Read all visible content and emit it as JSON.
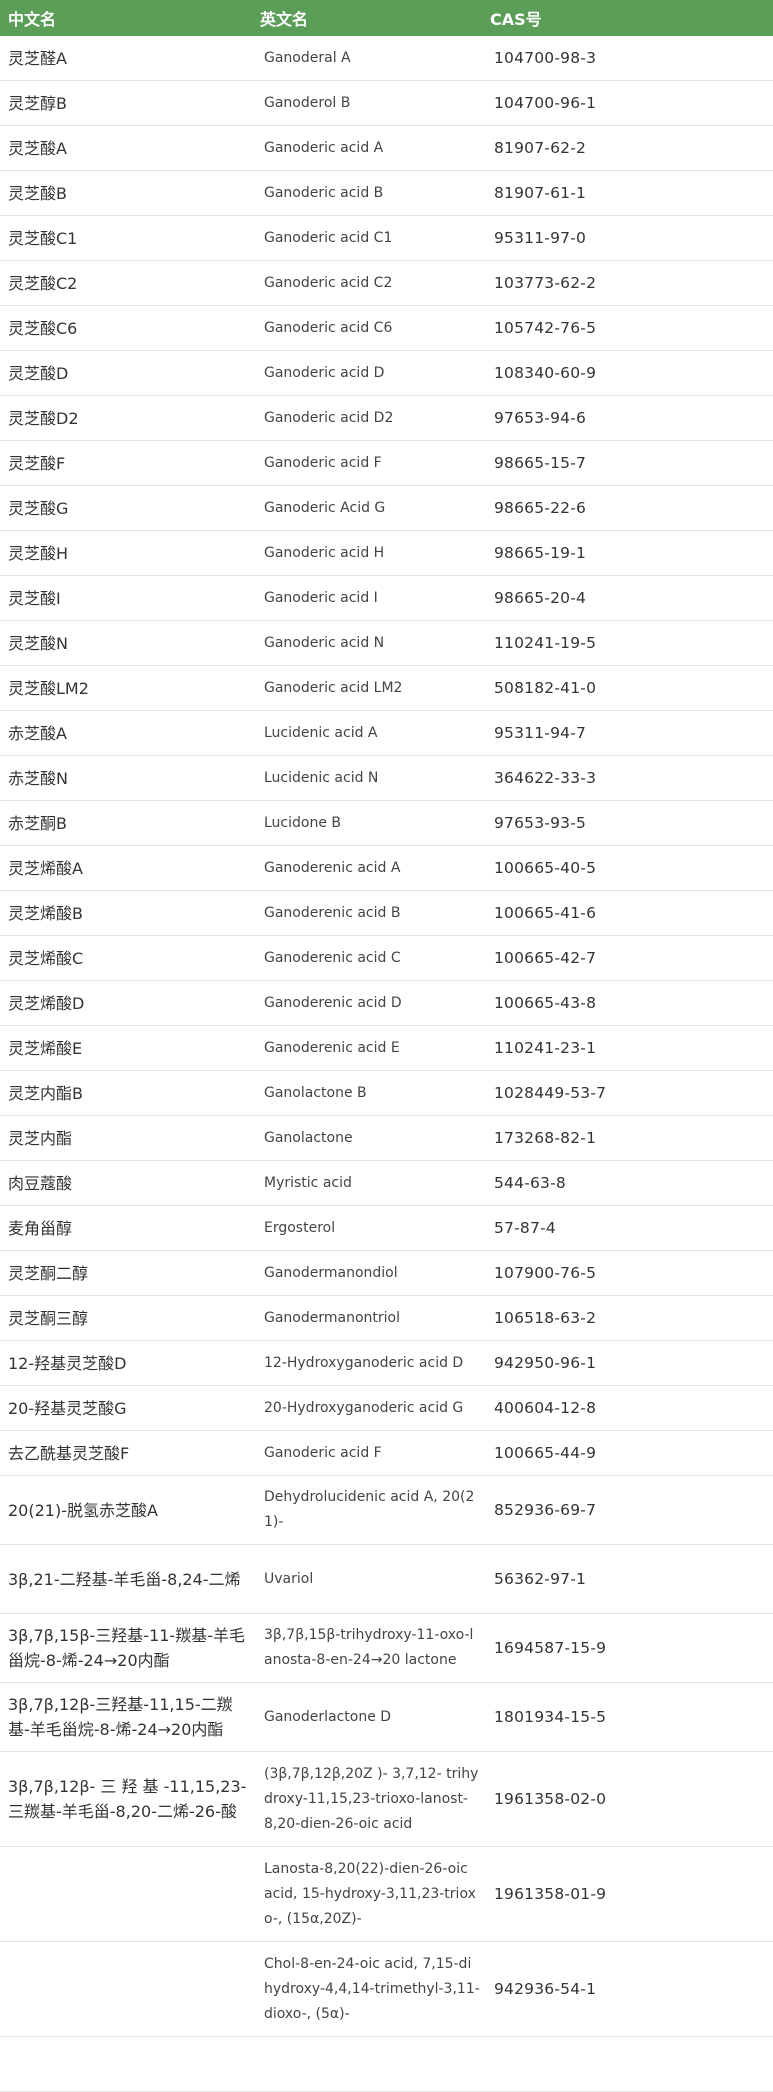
{
  "headers": {
    "chinese_name": "中文名",
    "english_name": "英文名",
    "cas_no": "CAS号"
  },
  "rows": [
    {
      "zh": "灵芝醛A",
      "en": "Ganoderal A",
      "cas": "104700-98-3"
    },
    {
      "zh": "灵芝醇B",
      "en": "Ganoderol B",
      "cas": "104700-96-1"
    },
    {
      "zh": "灵芝酸A",
      "en": "Ganoderic acid A",
      "cas": "81907-62-2"
    },
    {
      "zh": "灵芝酸B",
      "en": "Ganoderic acid B",
      "cas": "81907-61-1"
    },
    {
      "zh": "灵芝酸C1",
      "en": "Ganoderic acid C1",
      "cas": "95311-97-0"
    },
    {
      "zh": "灵芝酸C2",
      "en": "Ganoderic acid C2",
      "cas": "103773-62-2"
    },
    {
      "zh": "灵芝酸C6",
      "en": "Ganoderic acid C6",
      "cas": "105742-76-5"
    },
    {
      "zh": "灵芝酸D",
      "en": "Ganoderic acid D",
      "cas": "108340-60-9"
    },
    {
      "zh": "灵芝酸D2",
      "en": "Ganoderic acid D2",
      "cas": "97653-94-6"
    },
    {
      "zh": "灵芝酸F",
      "en": "Ganoderic acid F",
      "cas": "98665-15-7"
    },
    {
      "zh": "灵芝酸G",
      "en": "Ganoderic Acid G",
      "cas": "98665-22-6"
    },
    {
      "zh": "灵芝酸H",
      "en": "Ganoderic acid H",
      "cas": "98665-19-1"
    },
    {
      "zh": "灵芝酸I",
      "en": "Ganoderic acid I",
      "cas": "98665-20-4"
    },
    {
      "zh": "灵芝酸N",
      "en": "Ganoderic acid N",
      "cas": "110241-19-5"
    },
    {
      "zh": "灵芝酸LM2",
      "en": "Ganoderic acid LM2",
      "cas": "508182-41-0"
    },
    {
      "zh": "赤芝酸A",
      "en": "Lucidenic acid A",
      "cas": "95311-94-7"
    },
    {
      "zh": "赤芝酸N",
      "en": "Lucidenic acid N",
      "cas": "364622-33-3"
    },
    {
      "zh": "赤芝酮B",
      "en": "Lucidone B",
      "cas": "97653-93-5"
    },
    {
      "zh": "灵芝烯酸A",
      "en": "Ganoderenic acid A",
      "cas": "100665-40-5"
    },
    {
      "zh": "灵芝烯酸B",
      "en": "Ganoderenic acid B",
      "cas": "100665-41-6"
    },
    {
      "zh": "灵芝烯酸C",
      "en": "Ganoderenic acid C",
      "cas": "100665-42-7"
    },
    {
      "zh": "灵芝烯酸D",
      "en": "Ganoderenic acid D",
      "cas": "100665-43-8"
    },
    {
      "zh": "灵芝烯酸E",
      "en": "Ganoderenic acid E",
      "cas": "110241-23-1"
    },
    {
      "zh": "灵芝内酯B",
      "en": "Ganolactone B",
      "cas": "1028449-53-7"
    },
    {
      "zh": "灵芝内酯",
      "en": "Ganolactone",
      "cas": "173268-82-1"
    },
    {
      "zh": "肉豆蔻酸",
      "en": "Myristic acid",
      "cas": "544-63-8"
    },
    {
      "zh": "麦角甾醇",
      "en": "Ergosterol",
      "cas": "57-87-4"
    },
    {
      "zh": "灵芝酮二醇",
      "en": "Ganodermanondiol",
      "cas": "107900-76-5"
    },
    {
      "zh": "灵芝酮三醇",
      "en": "Ganodermanontriol",
      "cas": "106518-63-2"
    },
    {
      "zh": "12-羟基灵芝酸D",
      "en": "12-Hydroxyganoderic acid D",
      "cas": "942950-96-1"
    },
    {
      "zh": "20-羟基灵芝酸G",
      "en": "20-Hydroxyganoderic acid G",
      "cas": "400604-12-8"
    },
    {
      "zh": "去乙酰基灵芝酸F",
      "en": "Ganoderic acid F",
      "cas": "100665-44-9"
    },
    {
      "zh": "20(21)-脱氢赤芝酸A",
      "en": "Dehydrolucidenic acid A, 20(21)-",
      "cas": "852936-69-7"
    },
    {
      "zh": "3β,21-二羟基-羊毛甾-8,24-二烯",
      "en": "Uvariol",
      "cas": "56362-97-1"
    },
    {
      "zh": "3β,7β,15β-三羟基-11-羰基-羊毛甾烷-8-烯-24→20内酯",
      "en": "3β,7β,15β-trihydroxy-11-oxo-lanosta-8-en-24→20 lactone",
      "cas": "1694587-15-9"
    },
    {
      "zh": "3β,7β,12β-三羟基-11,15-二羰基-羊毛甾烷-8-烯-24→20内酯",
      "en": "Ganoderlactone D",
      "cas": "1801934-15-5"
    },
    {
      "zh": "3β,7β,12β- 三 羟 基 -11,15,23-三羰基-羊毛甾-8,20-二烯-26-酸",
      "en": "(3β,7β,12β,20Z )- 3,7,12- trihydroxy-11,15,23-trioxo-lanost-8,20-dien-26-oic acid",
      "cas": "1961358-02-0"
    },
    {
      "zh": "",
      "en": "Lanosta-8,20(22)-dien-26-oic acid, 15-hydroxy-3,11,23-trioxo-, (15α,20Z)-",
      "cas": "1961358-01-9"
    },
    {
      "zh": "",
      "en": "Chol-8-en-24-oic acid, 7,15-dihydroxy-4,4,14-trimethyl-3,11-dioxo-, (5α)-",
      "cas": "942936-54-1"
    }
  ]
}
